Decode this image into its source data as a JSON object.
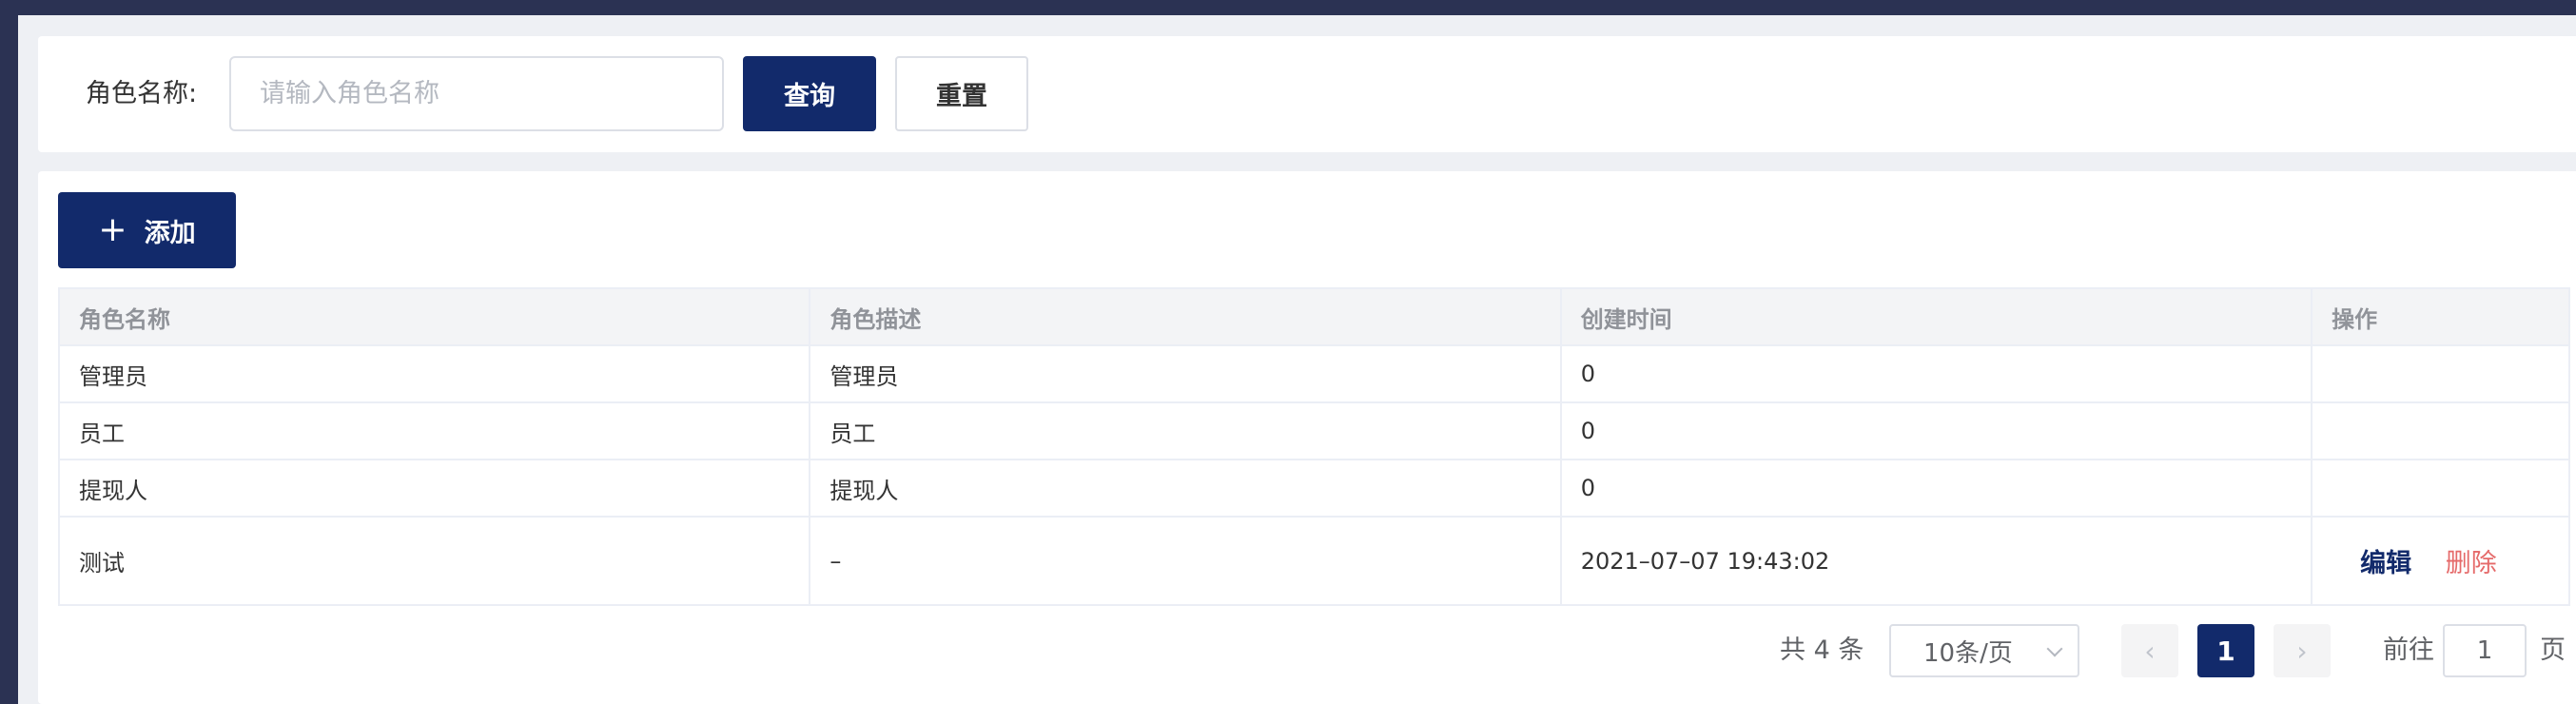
{
  "search": {
    "label": "角色名称:",
    "placeholder": "请输入角色名称",
    "value": "",
    "query_label": "查询",
    "reset_label": "重置"
  },
  "toolbar": {
    "add_icon": "+",
    "add_label": "添加"
  },
  "table": {
    "columns": [
      "角色名称",
      "角色描述",
      "创建时间",
      "操作"
    ],
    "rows": [
      {
        "name": "管理员",
        "desc": "管理员",
        "created": "0"
      },
      {
        "name": "员工",
        "desc": "员工",
        "created": "0"
      },
      {
        "name": "提现人",
        "desc": "提现人",
        "created": "0"
      },
      {
        "name": "测试",
        "desc": "–",
        "created": "2021–07–07 19:43:02",
        "edit_label": "编辑",
        "delete_label": "删除"
      }
    ]
  },
  "pagination": {
    "total_text": "共 4 条",
    "page_size": "10条/页",
    "prev_icon": "‹",
    "current_page": "1",
    "next_icon": "›",
    "goto_label": "前往",
    "goto_value": "1",
    "page_suffix": "页"
  },
  "colors": {
    "primary": "#122a6b",
    "danger": "#e56a6a",
    "sidebar": "#2b3253"
  }
}
